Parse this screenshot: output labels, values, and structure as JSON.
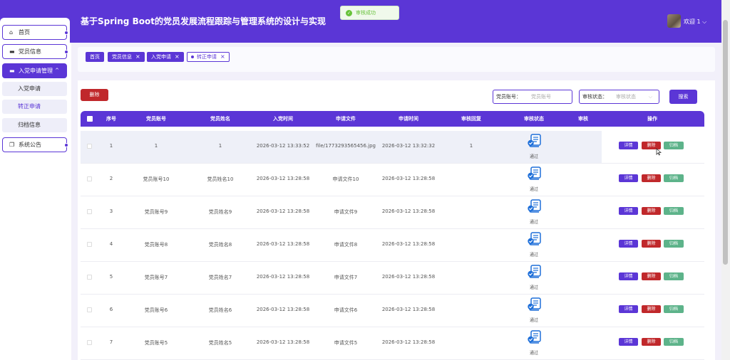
{
  "header": {
    "title": "基于Spring Boot的党员发展流程跟踪与管理系统的设计与实现",
    "welcome": "欢迎 1 ⌵"
  },
  "toast": {
    "text": "审核成功"
  },
  "sidebar": {
    "items": [
      {
        "label": "首页",
        "icon": "home-icon"
      },
      {
        "label": "党员信息",
        "icon": "card-icon"
      },
      {
        "label": "入党申请管理",
        "icon": "folder-icon",
        "caret": "^"
      },
      {
        "label": "系统公告",
        "icon": "copy-icon"
      }
    ],
    "subitems": [
      {
        "label": "入党申请"
      },
      {
        "label": "转正申请"
      },
      {
        "label": "归档信息"
      }
    ]
  },
  "tags": [
    {
      "label": "首页"
    },
    {
      "label": "党员信息",
      "close": "×"
    },
    {
      "label": "入党申请",
      "close": "×"
    },
    {
      "label": "转正申请",
      "close": "×"
    }
  ],
  "toolbar": {
    "delete_label": "删除",
    "search_label": "搜索",
    "account_label": "党员账号：",
    "account_placeholder": "党员账号",
    "status_label": "审核状态：",
    "status_placeholder": "审核状态"
  },
  "table": {
    "columns": [
      "序号",
      "党员账号",
      "党员姓名",
      "入党时间",
      "申请文件",
      "申请时间",
      "审核回复",
      "审核状态",
      "审核",
      "操作"
    ],
    "action_labels": {
      "detail": "详情",
      "delete": "删除",
      "archive": "归档"
    },
    "rows": [
      {
        "no": "1",
        "account": "1",
        "name": "1",
        "join_time": "2026-03-12 13:33:52",
        "file": "file/1773293565456.jpg",
        "apply_time": "2026-03-12 13:32:32",
        "reply": "1",
        "status": "通过"
      },
      {
        "no": "2",
        "account": "党员账号10",
        "name": "党员姓名10",
        "join_time": "2026-03-12 13:28:58",
        "file": "申请文件10",
        "apply_time": "2026-03-12 13:28:58",
        "reply": "",
        "status": "通过"
      },
      {
        "no": "3",
        "account": "党员账号9",
        "name": "党员姓名9",
        "join_time": "2026-03-12 13:28:58",
        "file": "申请文件9",
        "apply_time": "2026-03-12 13:28:58",
        "reply": "",
        "status": "通过"
      },
      {
        "no": "4",
        "account": "党员账号8",
        "name": "党员姓名8",
        "join_time": "2026-03-12 13:28:58",
        "file": "申请文件8",
        "apply_time": "2026-03-12 13:28:58",
        "reply": "",
        "status": "通过"
      },
      {
        "no": "5",
        "account": "党员账号7",
        "name": "党员姓名7",
        "join_time": "2026-03-12 13:28:58",
        "file": "申请文件7",
        "apply_time": "2026-03-12 13:28:58",
        "reply": "",
        "status": "通过"
      },
      {
        "no": "6",
        "account": "党员账号6",
        "name": "党员姓名6",
        "join_time": "2026-03-12 13:28:58",
        "file": "申请文件6",
        "apply_time": "2026-03-12 13:28:58",
        "reply": "",
        "status": "通过"
      },
      {
        "no": "7",
        "account": "党员账号5",
        "name": "党员姓名5",
        "join_time": "2026-03-12 13:28:58",
        "file": "申请文件5",
        "apply_time": "2026-03-12 13:28:58",
        "reply": "",
        "status": "通过"
      }
    ]
  },
  "colors": {
    "primary": "#5b36d6",
    "danger": "#c0282b",
    "success": "#5db38a"
  }
}
